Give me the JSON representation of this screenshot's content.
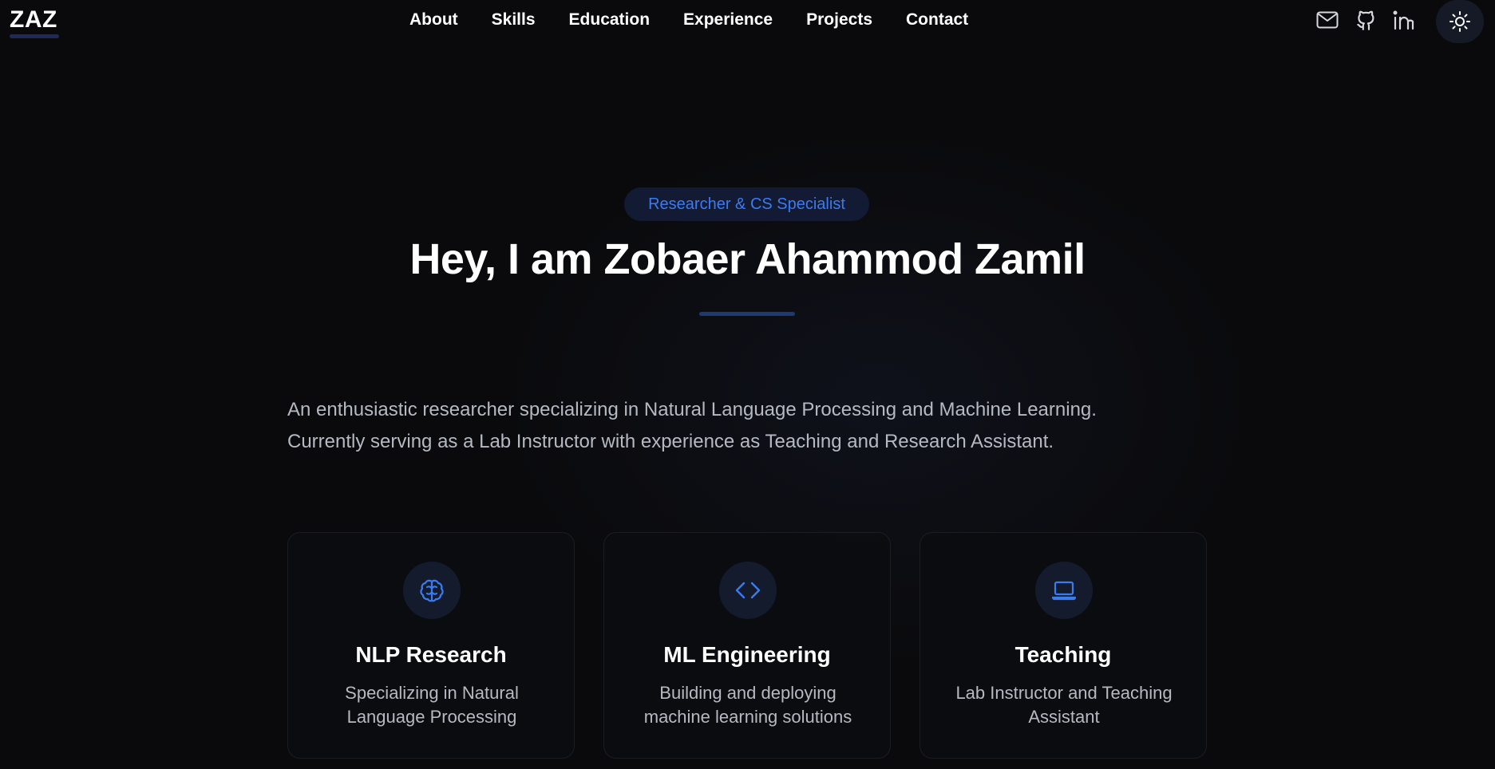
{
  "nav": {
    "logo": "ZAZ",
    "links": [
      "About",
      "Skills",
      "Education",
      "Experience",
      "Projects",
      "Contact"
    ],
    "icons": [
      "mail-icon",
      "github-icon",
      "linkedin-icon"
    ],
    "theme_toggle_icon": "sun-icon"
  },
  "hero": {
    "badge": "Researcher & CS Specialist",
    "headline": "Hey, I am Zobaer Ahammod Zamil",
    "intro_line1": "An enthusiastic researcher specializing in Natural Language Processing and Machine Learning.",
    "intro_line2": "Currently serving as a Lab Instructor with experience as Teaching and Research Assistant."
  },
  "cards": [
    {
      "icon": "brain-icon",
      "title": "NLP Research",
      "desc": "Specializing in Natural Language Processing"
    },
    {
      "icon": "code-icon",
      "title": "ML Engineering",
      "desc": "Building and deploying machine learning solutions"
    },
    {
      "icon": "laptop-icon",
      "title": "Teaching",
      "desc": "Lab Instructor and Teaching Assistant"
    }
  ],
  "colors": {
    "background": "#0a0a0c",
    "accent": "#3b7bf0",
    "text_muted": "#b5b9c2"
  }
}
